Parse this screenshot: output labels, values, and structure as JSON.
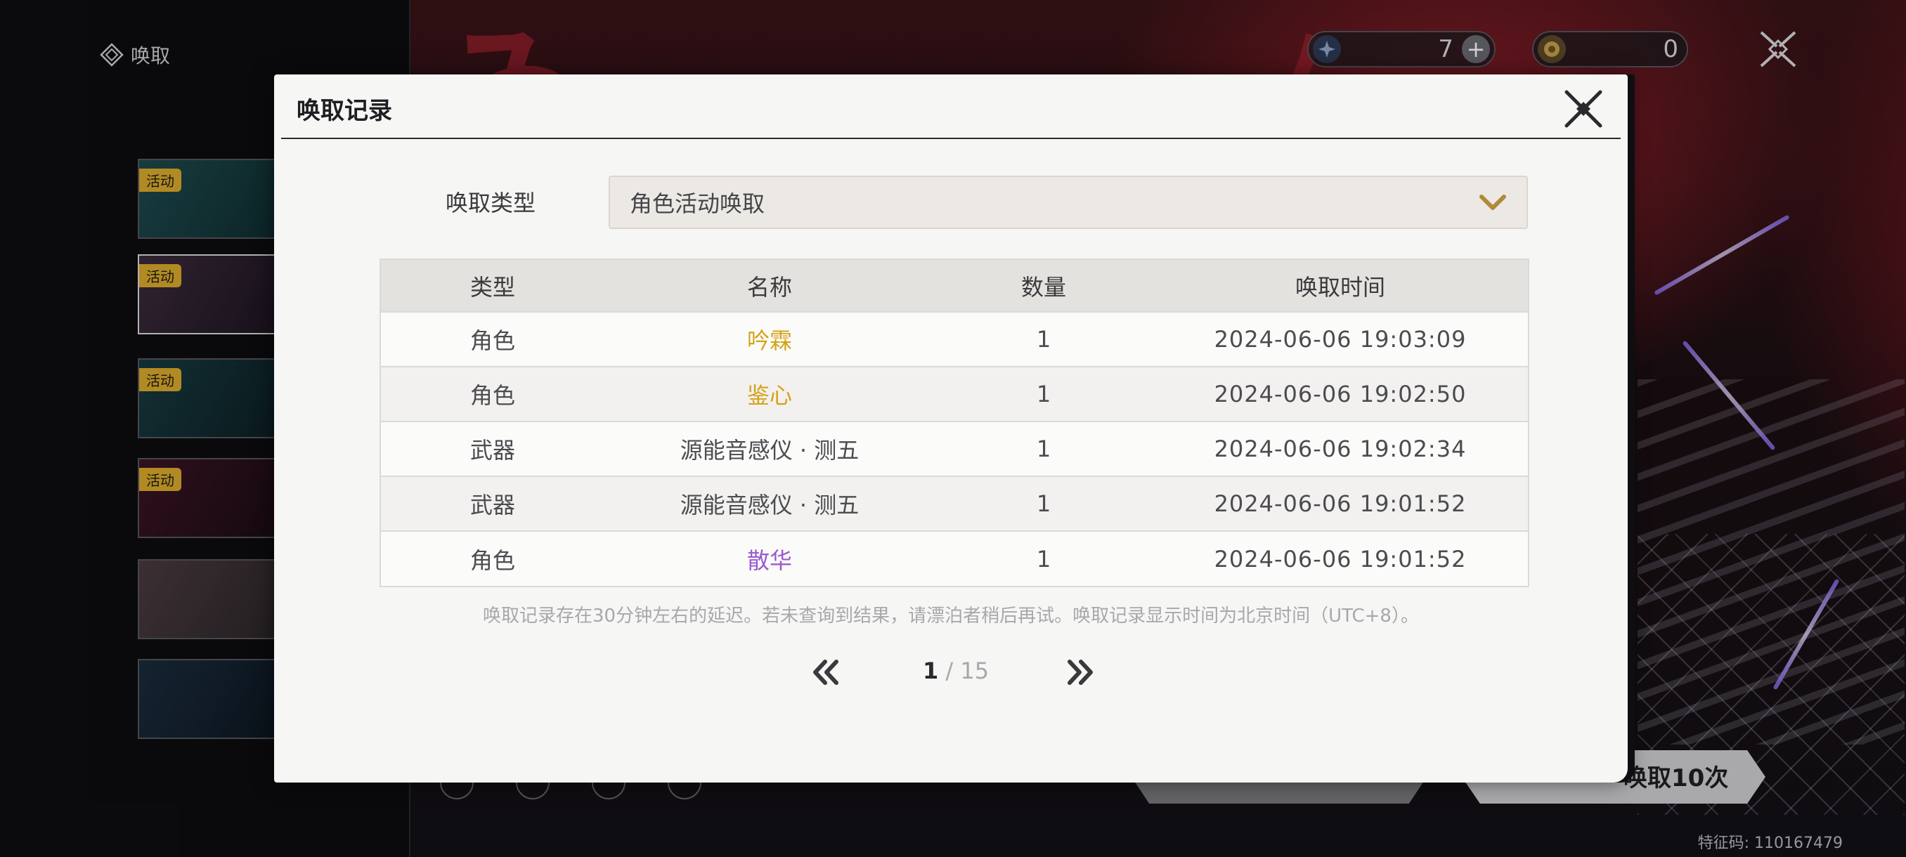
{
  "app": {
    "title": "唤取",
    "feature_code": "特征码: 110167479"
  },
  "currency": [
    {
      "icon": "astrite-icon",
      "value": "7",
      "color": "#8fa6c9"
    },
    {
      "icon": "lunite-icon",
      "value": "0",
      "color": "#c9a24a"
    }
  ],
  "banners": [
    {
      "tag": "活动"
    },
    {
      "tag": "活动"
    },
    {
      "tag": "活动"
    },
    {
      "tag": "活动"
    },
    {
      "tag": ""
    },
    {
      "tag": ""
    }
  ],
  "bottom": {
    "pull_10_label": "唤取10次"
  },
  "modal": {
    "title": "唤取记录",
    "type_label": "唤取类型",
    "type_selected": "角色活动唤取",
    "columns": [
      "类型",
      "名称",
      "数量",
      "唤取时间"
    ],
    "rows": [
      {
        "type": "角色",
        "name": "吟霖",
        "count": "1",
        "time": "2024-06-06 19:03:09",
        "rarity_color": "#d4a216"
      },
      {
        "type": "角色",
        "name": "鉴心",
        "count": "1",
        "time": "2024-06-06 19:02:50",
        "rarity_color": "#d4a216"
      },
      {
        "type": "武器",
        "name": "源能音感仪 · 测五",
        "count": "1",
        "time": "2024-06-06 19:02:34",
        "rarity_color": "#4c4c50"
      },
      {
        "type": "武器",
        "name": "源能音感仪 · 测五",
        "count": "1",
        "time": "2024-06-06 19:01:52",
        "rarity_color": "#4c4c50"
      },
      {
        "type": "角色",
        "name": "散华",
        "count": "1",
        "time": "2024-06-06 19:01:52",
        "rarity_color": "#9a5bd0"
      }
    ],
    "notice": "唤取记录存在30分钟左右的延迟。若未查询到结果，请漂泊者稍后再试。唤取记录显示时间为北京时间（UTC+8）。",
    "pagination": {
      "current": "1",
      "separator": " / ",
      "total": "15"
    }
  }
}
